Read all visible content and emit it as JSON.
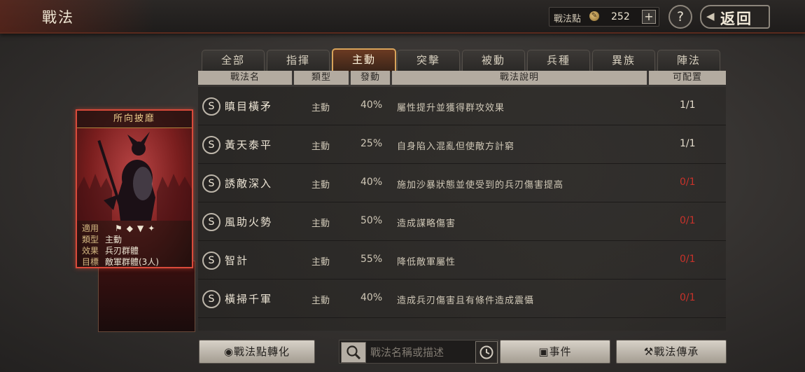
{
  "header": {
    "title": "戰法",
    "points_label": "戰法點",
    "points_value": "252",
    "plus": "+",
    "help": "?",
    "back_label": "返回"
  },
  "tabs": [
    {
      "label": "全部",
      "active": false
    },
    {
      "label": "指揮",
      "active": false
    },
    {
      "label": "主動",
      "active": true
    },
    {
      "label": "突擊",
      "active": false
    },
    {
      "label": "被動",
      "active": false
    },
    {
      "label": "兵種",
      "active": false
    },
    {
      "label": "異族",
      "active": false
    },
    {
      "label": "陣法",
      "active": false
    }
  ],
  "columns": {
    "name": "戰法名",
    "type": "類型",
    "rate": "發動",
    "desc": "戰法說明",
    "slots": "可配置"
  },
  "rows": [
    {
      "icon": "S",
      "name": "瞋目橫矛",
      "type": "主動",
      "rate": "40%",
      "desc": "屬性提升並獲得群攻效果",
      "slots": "1/1",
      "slots_red": false
    },
    {
      "icon": "S",
      "name": "黃天泰平",
      "type": "主動",
      "rate": "25%",
      "desc": "自身陷入混亂但使敵方計窮",
      "slots": "1/1",
      "slots_red": false
    },
    {
      "icon": "S",
      "name": "誘敵深入",
      "type": "主動",
      "rate": "40%",
      "desc": "施加沙暴狀態並使受到的兵刃傷害提高",
      "slots": "0/1",
      "slots_red": true
    },
    {
      "icon": "S",
      "name": "風助火勢",
      "type": "主動",
      "rate": "50%",
      "desc": "造成謀略傷害",
      "slots": "0/1",
      "slots_red": true
    },
    {
      "icon": "S",
      "name": "智計",
      "type": "主動",
      "rate": "55%",
      "desc": "降低敵軍屬性",
      "slots": "0/1",
      "slots_red": true
    },
    {
      "icon": "S",
      "name": "橫掃千軍",
      "type": "主動",
      "rate": "40%",
      "desc": "造成兵刃傷害且有條件造成震懾",
      "slots": "0/1",
      "slots_red": true
    }
  ],
  "card": {
    "title": "所向披靡",
    "info": [
      {
        "key": "適用",
        "value": ""
      },
      {
        "key": "類型",
        "value": "主動"
      },
      {
        "key": "效果",
        "value": "兵刃群體"
      },
      {
        "key": "目標",
        "value": "敵軍群體(3人)"
      }
    ]
  },
  "bottom": {
    "convert_label": "戰法點轉化",
    "search_placeholder": "戰法名稱或描述",
    "events_label": "事件",
    "inherit_label": "戰法傳承"
  },
  "colors": {
    "accent_tab_border": "#d8a35a",
    "slot_unavailable": "#c8322a",
    "card_border": "#d94a3a"
  }
}
